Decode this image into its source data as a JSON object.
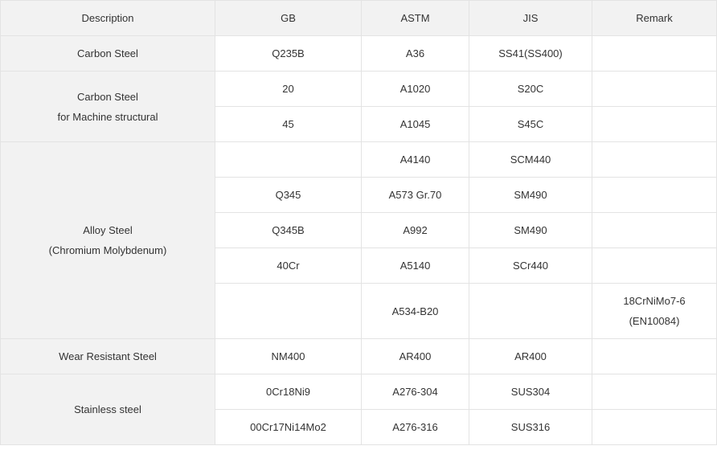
{
  "headers": [
    "Description",
    "GB",
    "ASTM",
    "JIS",
    "Remark"
  ],
  "rows": [
    {
      "desc": [
        "Carbon Steel"
      ],
      "gb": "Q235B",
      "astm": "A36",
      "jis": "SS41(SS400)",
      "remark": []
    },
    {
      "desc": [
        "Carbon Steel",
        "for Machine structural"
      ],
      "gb": "20",
      "astm": "A1020",
      "jis": "S20C",
      "remark": []
    },
    {
      "gb": "45",
      "astm": "A1045",
      "jis": "S45C",
      "remark": []
    },
    {
      "desc": [
        "Alloy Steel",
        "(Chromium Molybdenum)"
      ],
      "gb": "",
      "astm": "A4140",
      "jis": "SCM440",
      "remark": []
    },
    {
      "gb": "Q345",
      "astm": "A573 Gr.70",
      "jis": "SM490",
      "remark": []
    },
    {
      "gb": "Q345B",
      "astm": "A992",
      "jis": "SM490",
      "remark": []
    },
    {
      "gb": "40Cr",
      "astm": "A5140",
      "jis": "SCr440",
      "remark": []
    },
    {
      "gb": "",
      "astm": "A534-B20",
      "jis": "",
      "remark": [
        "18CrNiMo7-6",
        "(EN10084)"
      ]
    },
    {
      "desc": [
        "Wear Resistant Steel"
      ],
      "gb": "NM400",
      "astm": "AR400",
      "jis": "AR400",
      "remark": []
    },
    {
      "desc": [
        "Stainless steel"
      ],
      "gb": "0Cr18Ni9",
      "astm": "A276-304",
      "jis": "SUS304",
      "remark": []
    },
    {
      "gb": "00Cr17Ni14Mo2",
      "astm": "A276-316",
      "jis": "SUS316",
      "remark": []
    }
  ]
}
